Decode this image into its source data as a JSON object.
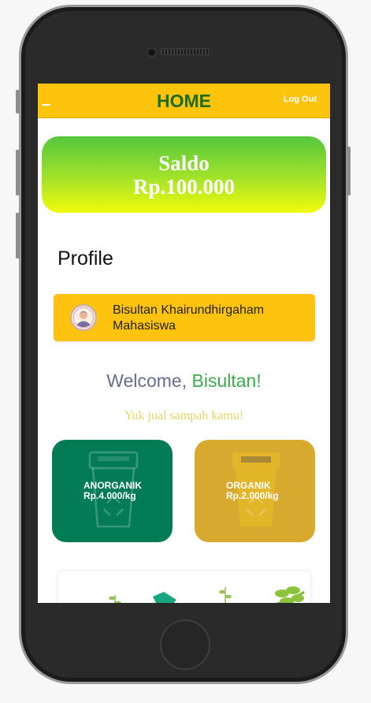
{
  "appbar": {
    "title": "HOME",
    "logout_label": "Log Out",
    "menu_icon": "menu-icon"
  },
  "saldo": {
    "label": "Saldo",
    "amount": "Rp.100.000"
  },
  "profile": {
    "heading": "Profile",
    "name": "Bisultan Khairundhirgaham",
    "role": "Mahasiswa",
    "avatar_icon": "user-avatar-icon"
  },
  "welcome": {
    "prefix": "Welcome, ",
    "name": "Bisultan!",
    "subtitle": "Yuk jual sampah kamu!"
  },
  "tiles": [
    {
      "title": "ANORGANIK",
      "price": "Rp.4.000/kg",
      "icon": "trash-bin-icon",
      "color": "#037b55"
    },
    {
      "title": "ORGANIK",
      "price": "Rp.2.000/kg",
      "icon": "trash-bin-icon",
      "color": "#d8a92f"
    }
  ],
  "colors": {
    "appbar": "#fdc40e",
    "home_title": "#1e6b1a",
    "welcome_name": "#39ab4a"
  }
}
